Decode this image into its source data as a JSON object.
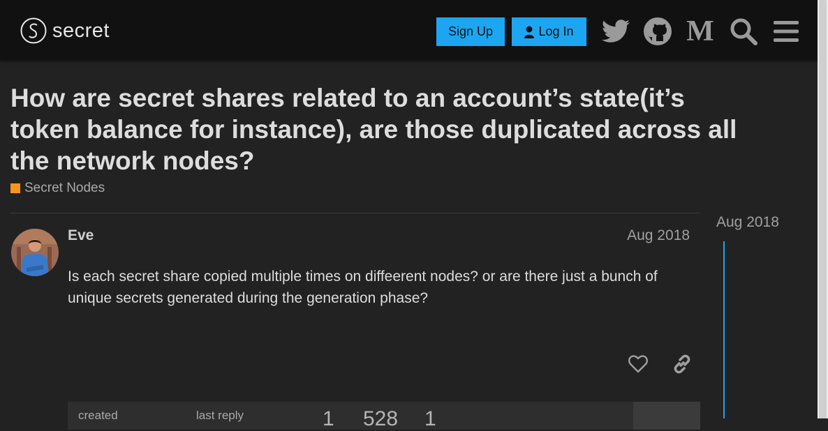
{
  "header": {
    "logo_text": "secret",
    "signup_label": "Sign Up",
    "login_label": "Log In",
    "icons": [
      "twitter-icon",
      "github-icon",
      "medium-icon",
      "search-icon",
      "hamburger-menu-icon"
    ]
  },
  "topic": {
    "title": "How are secret shares related to an account’s state(it’s token balance for instance), are those duplicated across all the network nodes?",
    "category": "Secret Nodes",
    "category_color": "#f7941d"
  },
  "post": {
    "username": "Eve",
    "date": "Aug 2018",
    "body": "Is each secret share copied multiple times on diffeerent nodes? or are there just a bunch of unique secrets generated during the generation phase?"
  },
  "timeline": {
    "date": "Aug 2018"
  },
  "topic_map": {
    "created_label": "created",
    "last_reply_label": "last reply",
    "stats": [
      "1",
      "528",
      "1"
    ]
  },
  "colors": {
    "accent": "#1ca6f2",
    "background": "#222222",
    "header_bg": "#111111"
  }
}
